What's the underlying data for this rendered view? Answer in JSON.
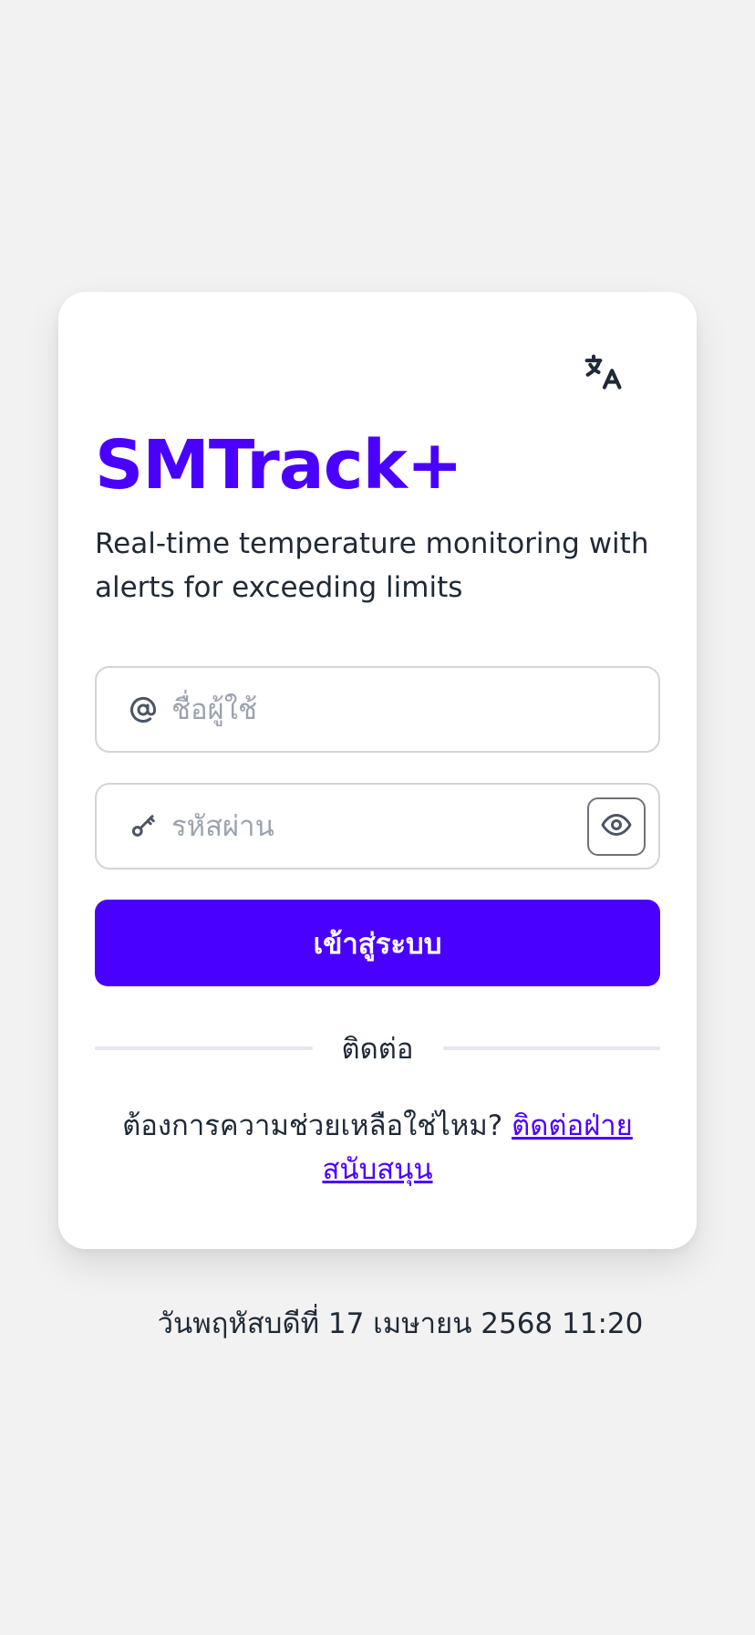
{
  "app": {
    "title": "SMTrack+",
    "subtitle": "Real-time temperature monitoring with alerts for exceeding limits"
  },
  "form": {
    "username_placeholder": "ชื่อผู้ใช้",
    "password_placeholder": "รหัสผ่าน",
    "username_value": "",
    "password_value": "",
    "login_label": "เข้าสู่ระบบ"
  },
  "divider": {
    "label": "ติดต่อ"
  },
  "help": {
    "question": "ต้องการความช่วยเหลือใช่ไหม? ",
    "link_label": "ติดต่อฝ่ายสนับสนุน"
  },
  "footer": {
    "datetime": "วันพฤหัสบดีที่ 17 เมษายน 2568 11:20"
  },
  "colors": {
    "brand": "#4a00ff",
    "background": "#f2f2f2",
    "card": "#ffffff",
    "text": "#1f2937",
    "placeholder": "#9ca3af"
  },
  "icons": {
    "language": "translate-icon",
    "username": "at-sign-icon",
    "password": "key-icon",
    "visibility": "eye-icon"
  }
}
